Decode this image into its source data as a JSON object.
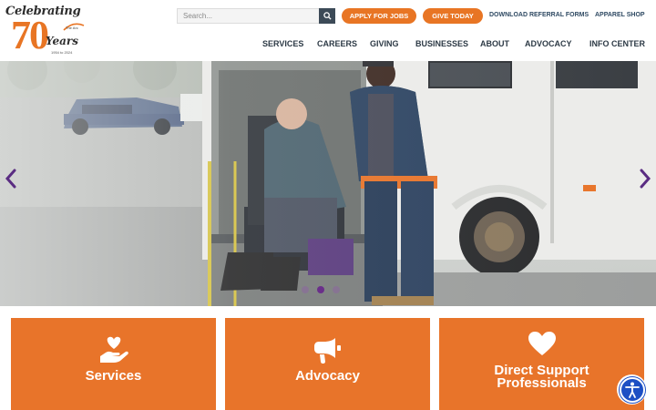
{
  "logo": {
    "script_top": "Celebrating",
    "number": "70",
    "script_bottom": "Years",
    "org_small": "The Arc",
    "dates": "1954 to 2024"
  },
  "search": {
    "placeholder": "Search..."
  },
  "top_buttons": {
    "apply": "APPLY FOR JOBS",
    "give": "GIVE TODAY"
  },
  "top_links": {
    "referral": "DOWNLOAD REFERRAL FORMS",
    "apparel": "APPAREL SHOP"
  },
  "nav": [
    "SERVICES",
    "CAREERS",
    "GIVING",
    "BUSINESSES",
    "ABOUT",
    "ADVOCACY",
    "INFO CENTER"
  ],
  "hero": {
    "slide_count": 3,
    "active_slide": 2
  },
  "cards": {
    "services": "Services",
    "advocacy": "Advocacy",
    "dsp_line1": "Direct Support",
    "dsp_line2": "Professionals"
  },
  "colors": {
    "brand_orange": "#e87524",
    "nav_text": "#2d3a46",
    "link_blue": "#2f4a63",
    "slider_purple": "#6a2f8a",
    "accessibility_blue": "#1d4fc4"
  },
  "icons": {
    "search_button": "search-icon",
    "services_card": "heart-in-hand-icon",
    "advocacy_card": "megaphone-icon",
    "dsp_card": "heart-icon",
    "accessibility": "accessibility-person-icon"
  }
}
